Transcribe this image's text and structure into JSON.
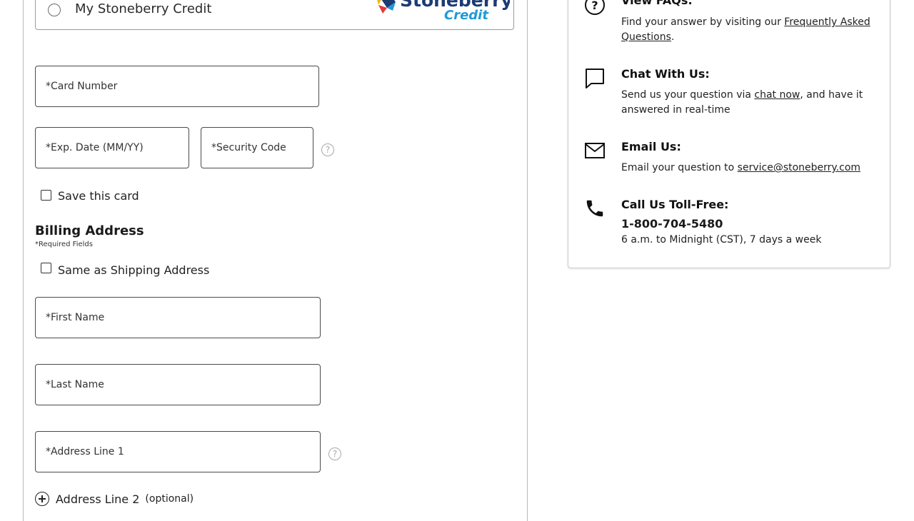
{
  "payment": {
    "option_label": "My Stoneberry Credit",
    "logo_text_main": "Stoneberry",
    "logo_text_sub": "Credit"
  },
  "card_form": {
    "card_number": "*Card Number",
    "exp_date": "*Exp. Date (MM/YY)",
    "security_code": "*Security Code",
    "save_card": "Save this card"
  },
  "billing": {
    "heading": "Billing Address",
    "required_note": "*Required Fields",
    "same_as_shipping": "Same as Shipping Address",
    "first_name": "*First Name",
    "last_name": "*Last Name",
    "address_line1": "*Address Line 1",
    "address_line2": "Address Line 2",
    "address_line2_optional": "(optional)"
  },
  "help": {
    "faq_title": "View FAQs:",
    "faq_text": "Find your answer by visiting our ",
    "faq_link": "Frequently Asked Questions",
    "faq_end": ".",
    "chat_title": "Chat With Us:",
    "chat_text1": "Send us your question via ",
    "chat_link": "chat now",
    "chat_text2": ", and have it answered in real-time",
    "email_title": "Email Us:",
    "email_text": "Email your question to ",
    "email_link": "service@stoneberry.com",
    "call_title": "Call Us Toll-Free:",
    "phone": "1-800-704-5480",
    "hours": "6 a.m. to Midnight (CST), 7 days a week"
  },
  "colors": {
    "brand_navy": "#1c3b73",
    "brand_teal": "#1e9ad6",
    "border": "#4a4a4a"
  }
}
